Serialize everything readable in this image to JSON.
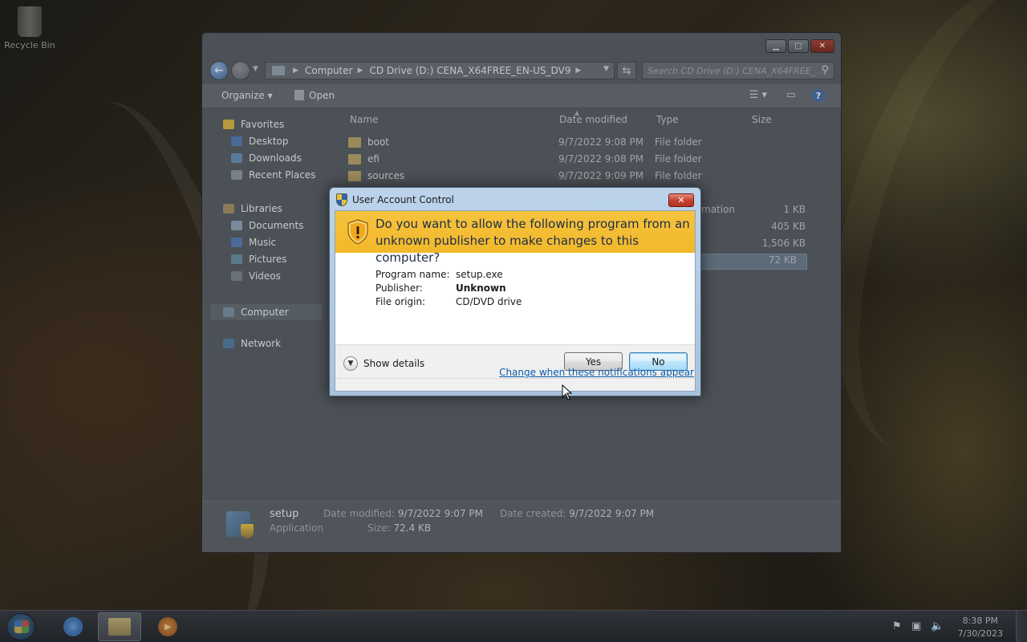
{
  "desktop": {
    "recycle_bin_label": "Recycle Bin"
  },
  "explorer": {
    "breadcrumbs": [
      "Computer",
      "CD Drive (D:) CENA_X64FREE_EN-US_DV9"
    ],
    "search_placeholder": "Search CD Drive (D:) CENA_X64FREE_...",
    "toolbar": {
      "organize_label": "Organize",
      "open_label": "Open"
    },
    "nav": {
      "favorites": "Favorites",
      "desktop": "Desktop",
      "downloads": "Downloads",
      "recent_places": "Recent Places",
      "libraries": "Libraries",
      "documents": "Documents",
      "music": "Music",
      "pictures": "Pictures",
      "videos": "Videos",
      "computer": "Computer",
      "network": "Network"
    },
    "columns": {
      "name": "Name",
      "date_modified": "Date modified",
      "type": "Type",
      "size": "Size"
    },
    "rows": [
      {
        "name": "boot",
        "date": "9/7/2022 9:08 PM",
        "type": "File folder",
        "size": ""
      },
      {
        "name": "efi",
        "date": "9/7/2022 9:08 PM",
        "type": "File folder",
        "size": ""
      },
      {
        "name": "sources",
        "date": "9/7/2022 9:09 PM",
        "type": "File folder",
        "size": ""
      }
    ],
    "hidden_rows": [
      {
        "type_fragment": "mation",
        "size": "1 KB"
      },
      {
        "type_fragment": "",
        "size": "405 KB"
      },
      {
        "type_fragment": "",
        "size": "1,506 KB"
      },
      {
        "type_fragment": "",
        "size": "72 KB"
      }
    ],
    "details": {
      "name": "setup",
      "kind": "Application",
      "date_modified_label": "Date modified:",
      "date_modified_value": "9/7/2022 9:07 PM",
      "date_created_label": "Date created:",
      "date_created_value": "9/7/2022 9:07 PM",
      "size_label": "Size:",
      "size_value": "72.4 KB"
    }
  },
  "uac": {
    "title": "User Account Control",
    "question": "Do you want to allow the following program from an unknown publisher to make changes to this computer?",
    "program_name_label": "Program name:",
    "program_name_value": "setup.exe",
    "publisher_label": "Publisher:",
    "publisher_value": "Unknown",
    "file_origin_label": "File origin:",
    "file_origin_value": "CD/DVD drive",
    "show_details_label": "Show details",
    "yes_label": "Yes",
    "no_label": "No",
    "change_link": "Change when these notifications appear",
    "banner_color": "#f4bf36"
  },
  "taskbar": {
    "time": "8:38 PM",
    "date": "7/30/2023"
  }
}
